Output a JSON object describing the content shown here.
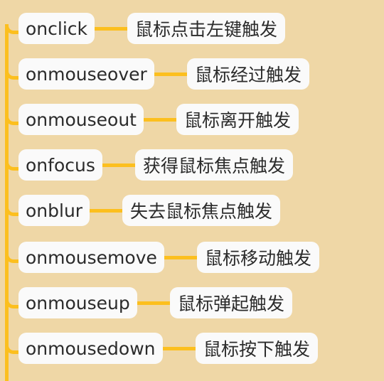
{
  "colors": {
    "background": "#efd7a6",
    "connector": "#fcbf1e",
    "node_fill": "#fafafa",
    "text": "#2b2b2b"
  },
  "nodes": [
    {
      "event": "onclick",
      "desc": "鼠标点击左键触发"
    },
    {
      "event": "onmouseover",
      "desc": "鼠标经过触发"
    },
    {
      "event": "onmouseout",
      "desc": "鼠标离开触发"
    },
    {
      "event": "onfocus",
      "desc": "获得鼠标焦点触发"
    },
    {
      "event": "onblur",
      "desc": "失去鼠标焦点触发"
    },
    {
      "event": "onmousemove",
      "desc": "鼠标移动触发"
    },
    {
      "event": "onmouseup",
      "desc": "鼠标弹起触发"
    },
    {
      "event": "onmousedown",
      "desc": "鼠标按下触发"
    }
  ]
}
